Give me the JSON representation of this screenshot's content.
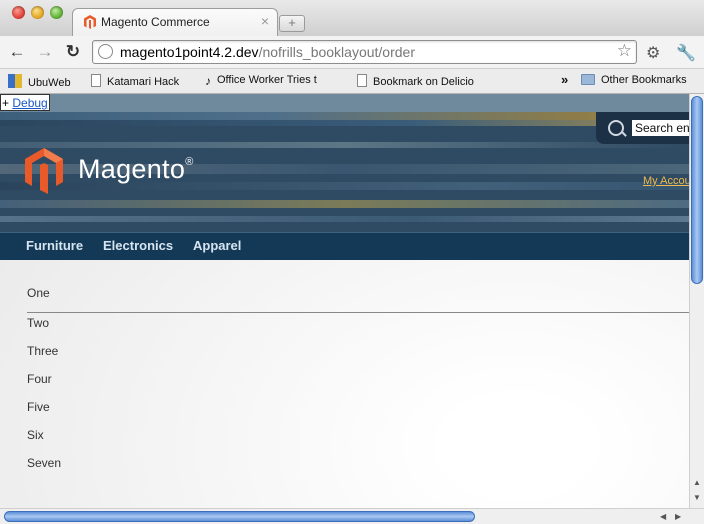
{
  "browser": {
    "tab_title": "Magento Commerce",
    "url_host": "magento1point4.2.dev",
    "url_path": "/nofrills_booklayout/order"
  },
  "bookmarks": [
    {
      "label": "UbuWeb"
    },
    {
      "label": "Katamari Hack"
    },
    {
      "label": "Office Worker Tries t"
    },
    {
      "label": "Bookmark on Delicio"
    },
    {
      "label": "Other Bookmarks"
    }
  ],
  "bookmarks_overflow": "»",
  "debug": {
    "prefix": "+",
    "link": "Debug"
  },
  "header": {
    "logo_text": "Magento",
    "logo_mark": "®",
    "search_value": "Search en",
    "my_account": "My Accou"
  },
  "nav": [
    "Furniture",
    "Electronics",
    "Apparel"
  ],
  "items": [
    "One",
    "Two",
    "Three",
    "Four",
    "Five",
    "Six",
    "Seven"
  ],
  "colors": {
    "header_bg": "#2f4a63",
    "nav_bg": "#143956",
    "logo_orange": "#e85a2a",
    "link_orange": "#f0b94a"
  },
  "icons": {
    "back": "←",
    "forward": "→",
    "reload": "↻",
    "star": "☆",
    "settings": "⚙",
    "wrench": "🔧",
    "tab_close": "×",
    "new_tab": "+"
  }
}
